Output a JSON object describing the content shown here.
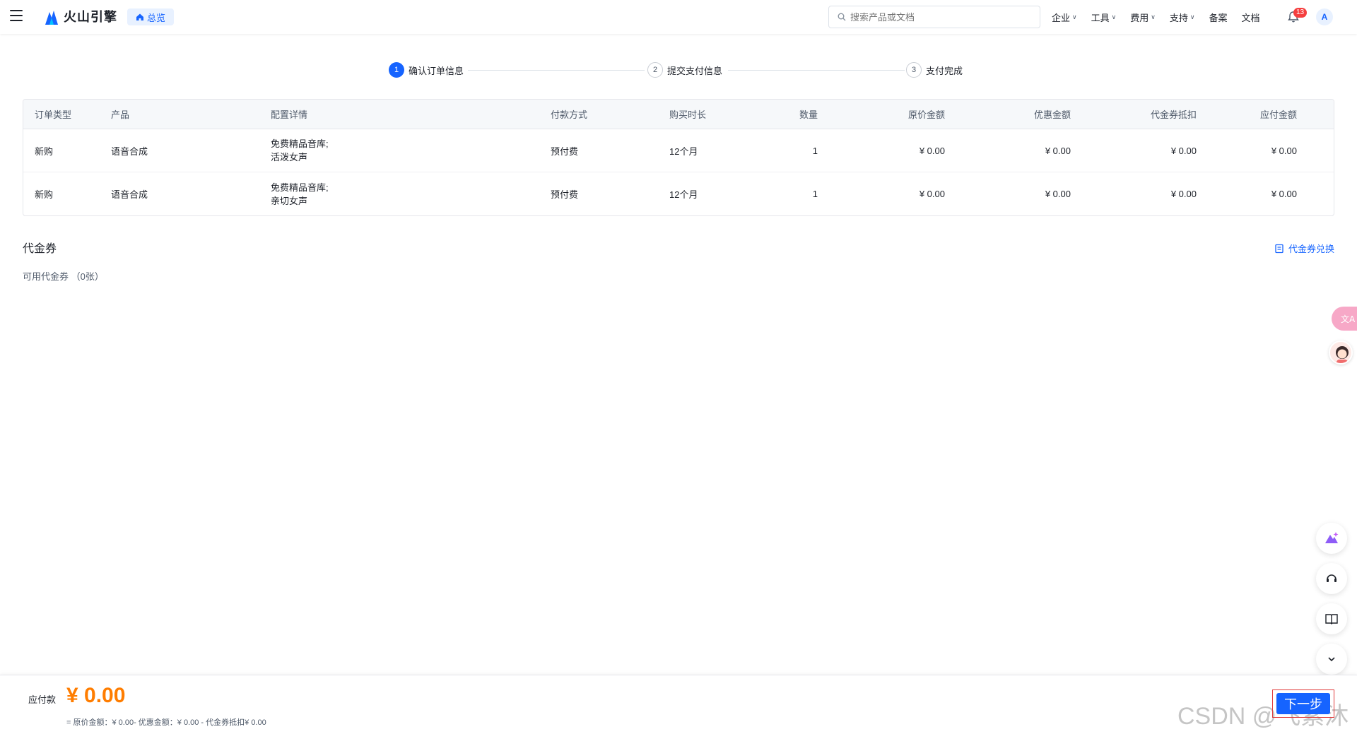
{
  "header": {
    "brand": "火山引擎",
    "home_label": "总览",
    "search_placeholder": "搜索产品或文档",
    "nav": [
      "企业",
      "工具",
      "费用",
      "支持"
    ],
    "nav_plain": [
      "备案",
      "文档"
    ],
    "notification_count": "13",
    "avatar_initial": "A"
  },
  "steps": [
    {
      "num": "1",
      "label": "确认订单信息"
    },
    {
      "num": "2",
      "label": "提交支付信息"
    },
    {
      "num": "3",
      "label": "支付完成"
    }
  ],
  "table": {
    "columns": [
      "订单类型",
      "产品",
      "配置详情",
      "付款方式",
      "购买时长",
      "数量",
      "原价金额",
      "优惠金额",
      "代金券抵扣",
      "应付金额"
    ],
    "rows": [
      {
        "type": "新购",
        "product": "语音合成",
        "config_line1": "免费精品音库;",
        "config_line2": "活泼女声",
        "payment": "预付费",
        "duration": "12个月",
        "qty": "1",
        "original": "¥ 0.00",
        "discount": "¥ 0.00",
        "voucher": "¥ 0.00",
        "payable": "¥ 0.00"
      },
      {
        "type": "新购",
        "product": "语音合成",
        "config_line1": "免费精品音库;",
        "config_line2": "亲切女声",
        "payment": "预付费",
        "duration": "12个月",
        "qty": "1",
        "original": "¥ 0.00",
        "discount": "¥ 0.00",
        "voucher": "¥ 0.00",
        "payable": "¥ 0.00"
      }
    ]
  },
  "voucher": {
    "title": "代金券",
    "redeem_label": "代金券兑换",
    "available": "可用代金券 （0张）"
  },
  "footer": {
    "pay_label": "应付款",
    "amount": "¥ 0.00",
    "detail": "= 原价金额：¥ 0.00- 优惠金额：¥ 0.00 - 代金券抵扣¥ 0.00",
    "next_label": "下一步",
    "watermark": "CSDN @飞紫沐"
  },
  "colors": {
    "primary": "#1664ff",
    "amount": "#ff7d00",
    "badge": "#f53f3f"
  }
}
